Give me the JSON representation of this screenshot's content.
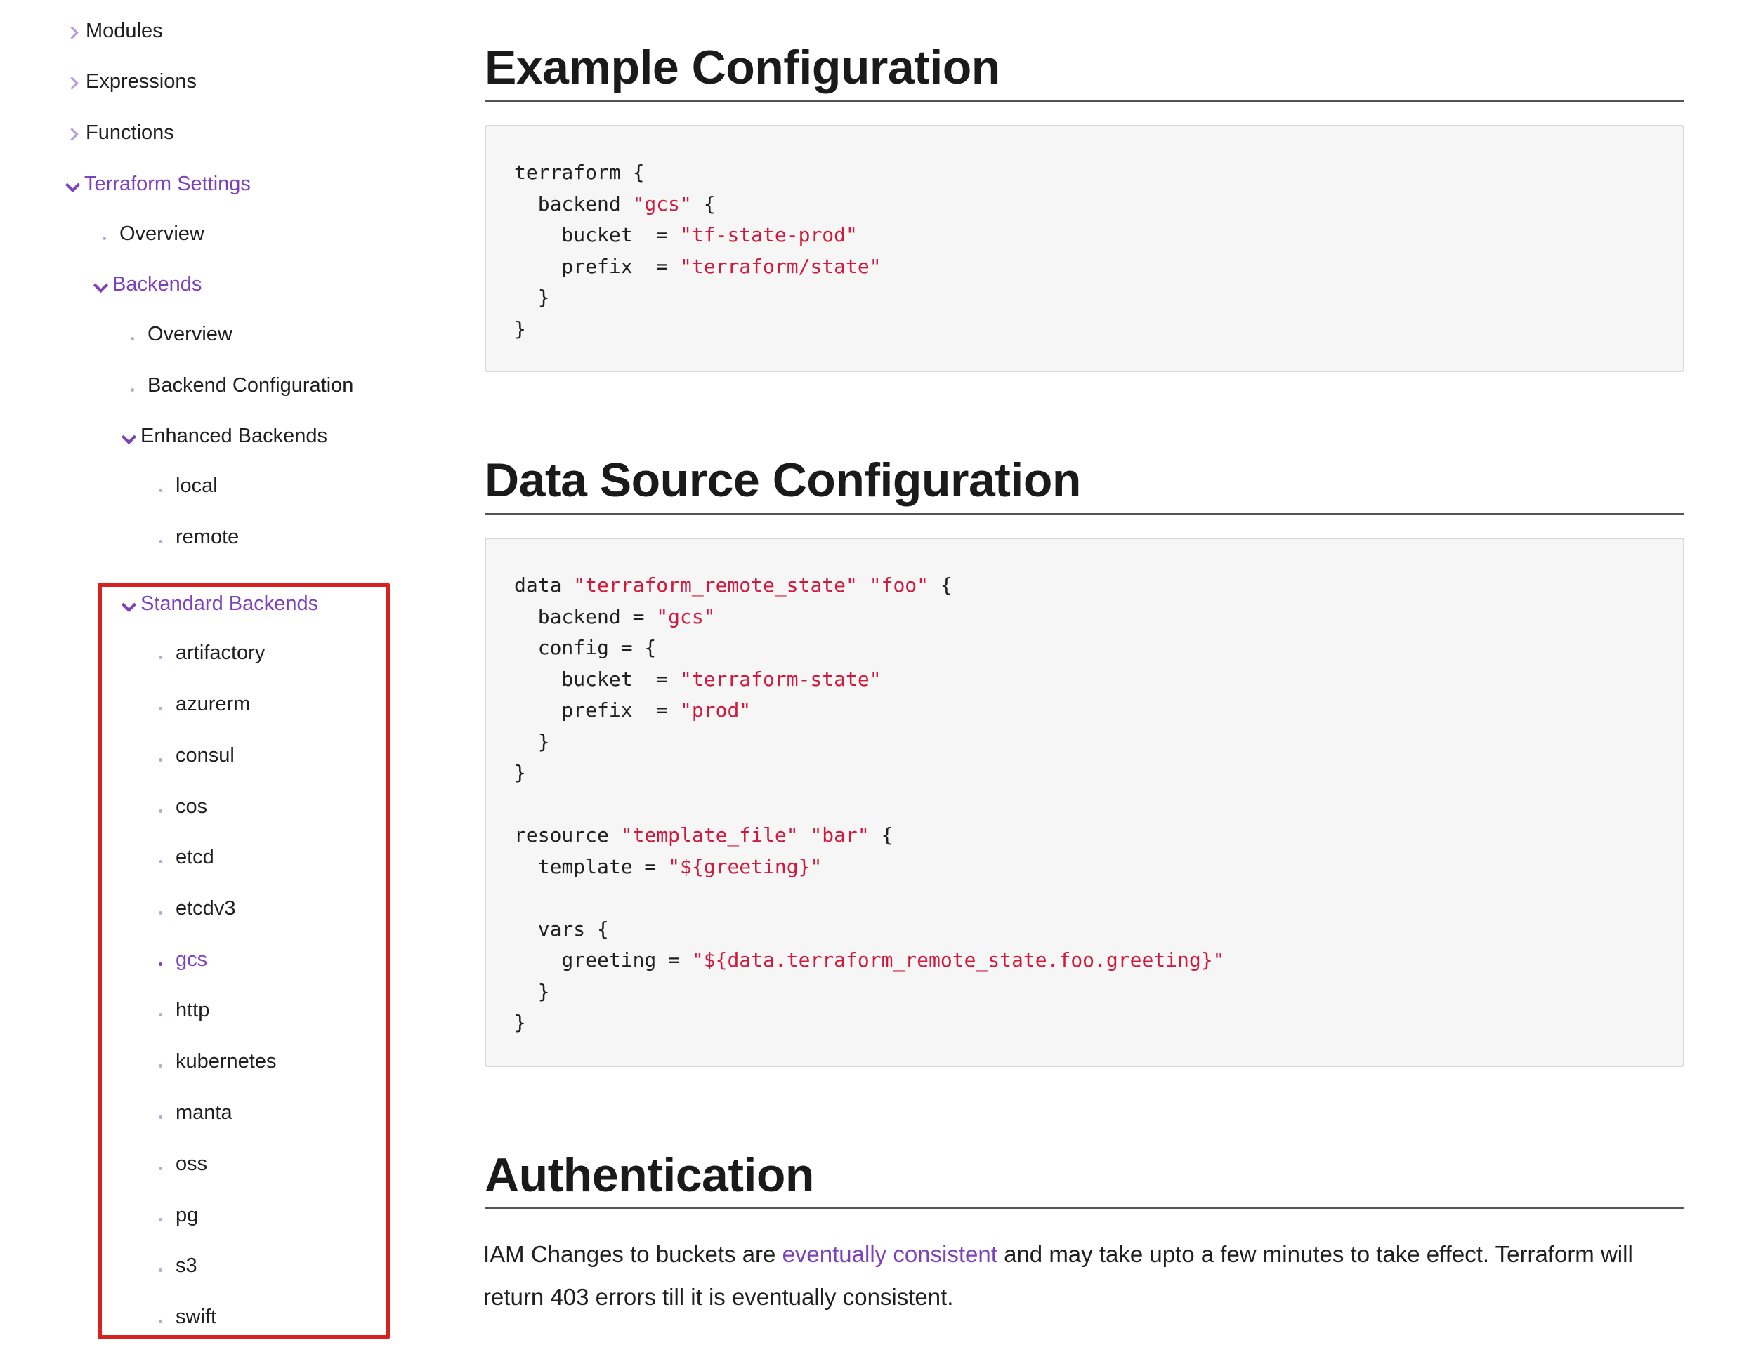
{
  "sidebar": {
    "items": [
      {
        "label": "Modules",
        "marker": "chevron-right",
        "color": "#1f1f1f"
      },
      {
        "label": "Expressions",
        "marker": "chevron-right",
        "color": "#1f1f1f"
      },
      {
        "label": "Functions",
        "marker": "chevron-right",
        "color": "#1f1f1f"
      },
      {
        "label": "Terraform Settings",
        "marker": "chevron-down",
        "color": "#7b42bc"
      },
      {
        "label": "Overview",
        "marker": "bullet",
        "color": "#1f1f1f"
      },
      {
        "label": "Backends",
        "marker": "chevron-down",
        "color": "#7b42bc"
      },
      {
        "label": "Overview",
        "marker": "bullet",
        "color": "#1f1f1f"
      },
      {
        "label": "Backend Configuration",
        "marker": "bullet",
        "color": "#1f1f1f"
      },
      {
        "label": "Enhanced Backends",
        "marker": "chevron-down",
        "color": "#1f1f1f"
      },
      {
        "label": "local",
        "marker": "bullet",
        "color": "#1f1f1f"
      },
      {
        "label": "remote",
        "marker": "bullet",
        "color": "#1f1f1f"
      },
      {
        "label": "Standard Backends",
        "marker": "chevron-down",
        "color": "#7b42bc"
      },
      {
        "label": "artifactory",
        "marker": "bullet",
        "color": "#1f1f1f"
      },
      {
        "label": "azurerm",
        "marker": "bullet",
        "color": "#1f1f1f"
      },
      {
        "label": "consul",
        "marker": "bullet",
        "color": "#1f1f1f"
      },
      {
        "label": "cos",
        "marker": "bullet",
        "color": "#1f1f1f"
      },
      {
        "label": "etcd",
        "marker": "bullet",
        "color": "#1f1f1f"
      },
      {
        "label": "etcdv3",
        "marker": "bullet",
        "color": "#1f1f1f"
      },
      {
        "label": "gcs",
        "marker": "bullet",
        "color": "#7b42bc",
        "active": true
      },
      {
        "label": "http",
        "marker": "bullet",
        "color": "#1f1f1f"
      },
      {
        "label": "kubernetes",
        "marker": "bullet",
        "color": "#1f1f1f"
      },
      {
        "label": "manta",
        "marker": "bullet",
        "color": "#1f1f1f"
      },
      {
        "label": "oss",
        "marker": "bullet",
        "color": "#1f1f1f"
      },
      {
        "label": "pg",
        "marker": "bullet",
        "color": "#1f1f1f"
      },
      {
        "label": "s3",
        "marker": "bullet",
        "color": "#1f1f1f"
      },
      {
        "label": "swift",
        "marker": "bullet",
        "color": "#1f1f1f"
      }
    ],
    "highlight_color": "#d6231f"
  },
  "main": {
    "example": {
      "title": "Example Configuration",
      "code": [
        [
          {
            "t": "terraform {"
          }
        ],
        [
          {
            "t": "  backend "
          },
          {
            "t": "\"gcs\"",
            "s": true
          },
          {
            "t": " {"
          }
        ],
        [
          {
            "t": "    bucket  = "
          },
          {
            "t": "\"tf-state-prod\"",
            "s": true
          }
        ],
        [
          {
            "t": "    prefix  = "
          },
          {
            "t": "\"terraform/state\"",
            "s": true
          }
        ],
        [
          {
            "t": "  }"
          }
        ],
        [
          {
            "t": "}"
          }
        ]
      ]
    },
    "data_source": {
      "title": "Data Source Configuration",
      "code": [
        [
          {
            "t": "data "
          },
          {
            "t": "\"terraform_remote_state\"",
            "s": true
          },
          {
            "t": " "
          },
          {
            "t": "\"foo\"",
            "s": true
          },
          {
            "t": " {"
          }
        ],
        [
          {
            "t": "  backend = "
          },
          {
            "t": "\"gcs\"",
            "s": true
          }
        ],
        [
          {
            "t": "  config = {"
          }
        ],
        [
          {
            "t": "    bucket  = "
          },
          {
            "t": "\"terraform-state\"",
            "s": true
          }
        ],
        [
          {
            "t": "    prefix  = "
          },
          {
            "t": "\"prod\"",
            "s": true
          }
        ],
        [
          {
            "t": "  }"
          }
        ],
        [
          {
            "t": "}"
          }
        ],
        [
          {
            "t": ""
          }
        ],
        [
          {
            "t": "resource "
          },
          {
            "t": "\"template_file\"",
            "s": true
          },
          {
            "t": " "
          },
          {
            "t": "\"bar\"",
            "s": true
          },
          {
            "t": " {"
          }
        ],
        [
          {
            "t": "  template = "
          },
          {
            "t": "\"${greeting}\"",
            "s": true
          }
        ],
        [
          {
            "t": ""
          }
        ],
        [
          {
            "t": "  vars {"
          }
        ],
        [
          {
            "t": "    greeting = "
          },
          {
            "t": "\"${data.terraform_remote_state.foo.greeting}\"",
            "s": true
          }
        ],
        [
          {
            "t": "  }"
          }
        ],
        [
          {
            "t": "}"
          }
        ]
      ]
    },
    "authentication": {
      "title": "Authentication",
      "text_before": "IAM Changes to buckets are ",
      "link_text": "eventually consistent",
      "text_after": " and may take upto a few minutes to take effect. Terraform will return 403 errors till it is eventually consistent."
    }
  },
  "colors": {
    "accent": "#7b42bc",
    "code_string": "#d01a3d",
    "code_bg": "#f6f6f6"
  }
}
